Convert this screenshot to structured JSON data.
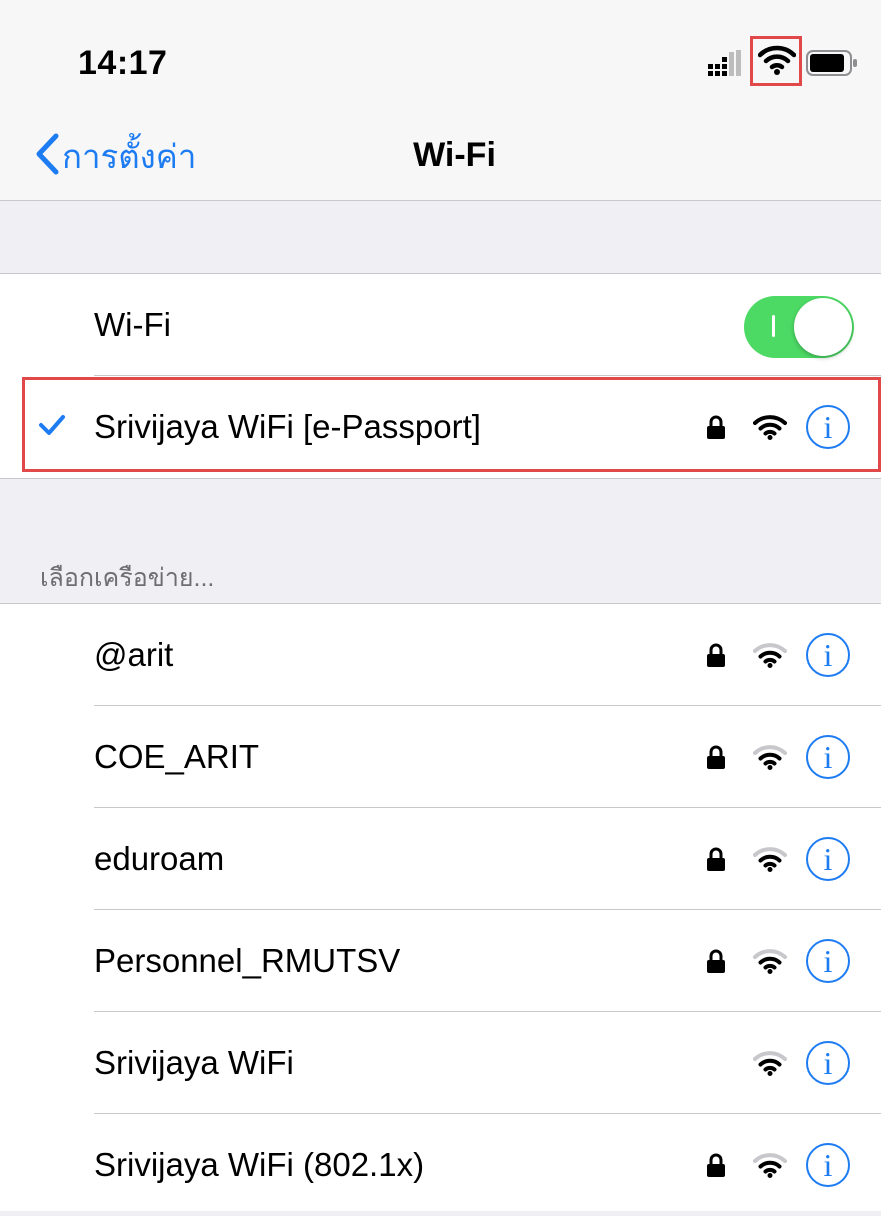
{
  "status_bar": {
    "time": "14:17",
    "icons": [
      "cellular-signal-icon",
      "wifi-icon",
      "battery-icon"
    ]
  },
  "nav": {
    "back_label": "การตั้งค่า",
    "title": "Wi-Fi"
  },
  "wifi_toggle": {
    "label": "Wi-Fi",
    "on": true
  },
  "connected_network": {
    "name": "Srivijaya WiFi [e-Passport]",
    "locked": true,
    "info_glyph": "i"
  },
  "networks_section": {
    "header": "เลือกเครือข่าย...",
    "items": [
      {
        "name": "@arit",
        "locked": true,
        "info_glyph": "i"
      },
      {
        "name": "COE_ARIT",
        "locked": true,
        "info_glyph": "i"
      },
      {
        "name": "eduroam",
        "locked": true,
        "info_glyph": "i"
      },
      {
        "name": "Personnel_RMUTSV",
        "locked": true,
        "info_glyph": "i"
      },
      {
        "name": "Srivijaya WiFi",
        "locked": false,
        "info_glyph": "i"
      },
      {
        "name": "Srivijaya WiFi (802.1x)",
        "locked": true,
        "info_glyph": "i"
      }
    ]
  },
  "colors": {
    "accent": "#1e7cf2",
    "toggle_on": "#4cd964",
    "highlight": "#e0484a",
    "background": "#efeff4"
  }
}
